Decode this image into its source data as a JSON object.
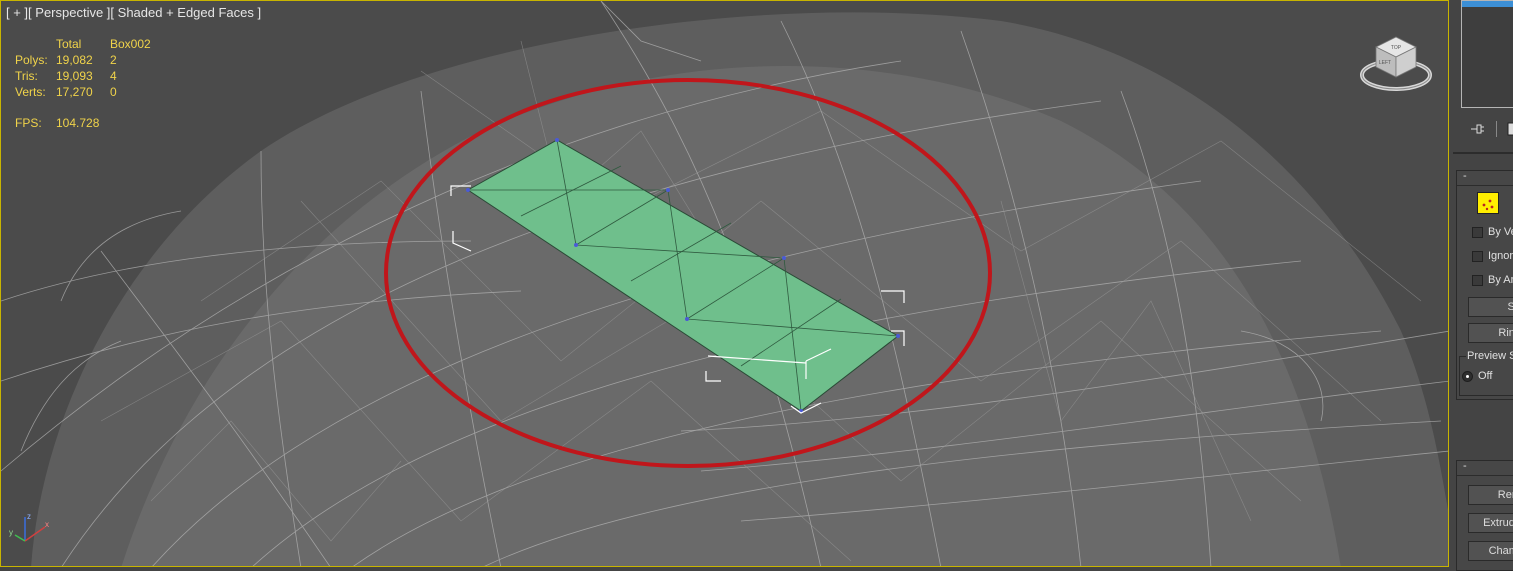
{
  "viewport": {
    "menu_plus": "[ + ]",
    "menu_view": "[ Perspective ]",
    "menu_shading": "[ Shaded + Edged Faces ]",
    "colors": {
      "border_active": "#c8b400",
      "stat_text": "#f0d34a",
      "highlight_circle": "#c0161b",
      "selected_poly": "#6fbf8c"
    }
  },
  "stats": {
    "header": {
      "total": "Total",
      "object": "Box002"
    },
    "rows": [
      {
        "label": "Polys:",
        "total": "19,082",
        "object": "2"
      },
      {
        "label": "Tris:",
        "total": "19,093",
        "object": "4"
      },
      {
        "label": "Verts:",
        "total": "17,270",
        "object": "0"
      }
    ],
    "fps_label": "FPS:",
    "fps_value": "104.728"
  },
  "viewcube": {
    "icon": "viewcube-icon",
    "face_labels": [
      "TOP",
      "LEFT"
    ]
  },
  "axis_gizmo": {
    "x": "x",
    "y": "y",
    "z": "z"
  },
  "command_panel": {
    "toolbar": {
      "pin_icon": "pin-stack-icon",
      "modifier_icon": "show-end-result-icon"
    },
    "selection_rollout": {
      "collapse": "-",
      "vertex_icon": "vertex-subobject-icon",
      "checkboxes": [
        {
          "label": "By Ve",
          "checked": false
        },
        {
          "label": "Ignor",
          "checked": false
        },
        {
          "label": "By An",
          "checked": false
        }
      ],
      "buttons": [
        "Sh",
        "Ring"
      ],
      "preview_group": {
        "title": "Preview S",
        "option": "Off",
        "selected": true
      }
    },
    "edit_rollout": {
      "collapse": "-",
      "buttons": [
        "Rem",
        "Extrude",
        "Chamf"
      ]
    }
  }
}
